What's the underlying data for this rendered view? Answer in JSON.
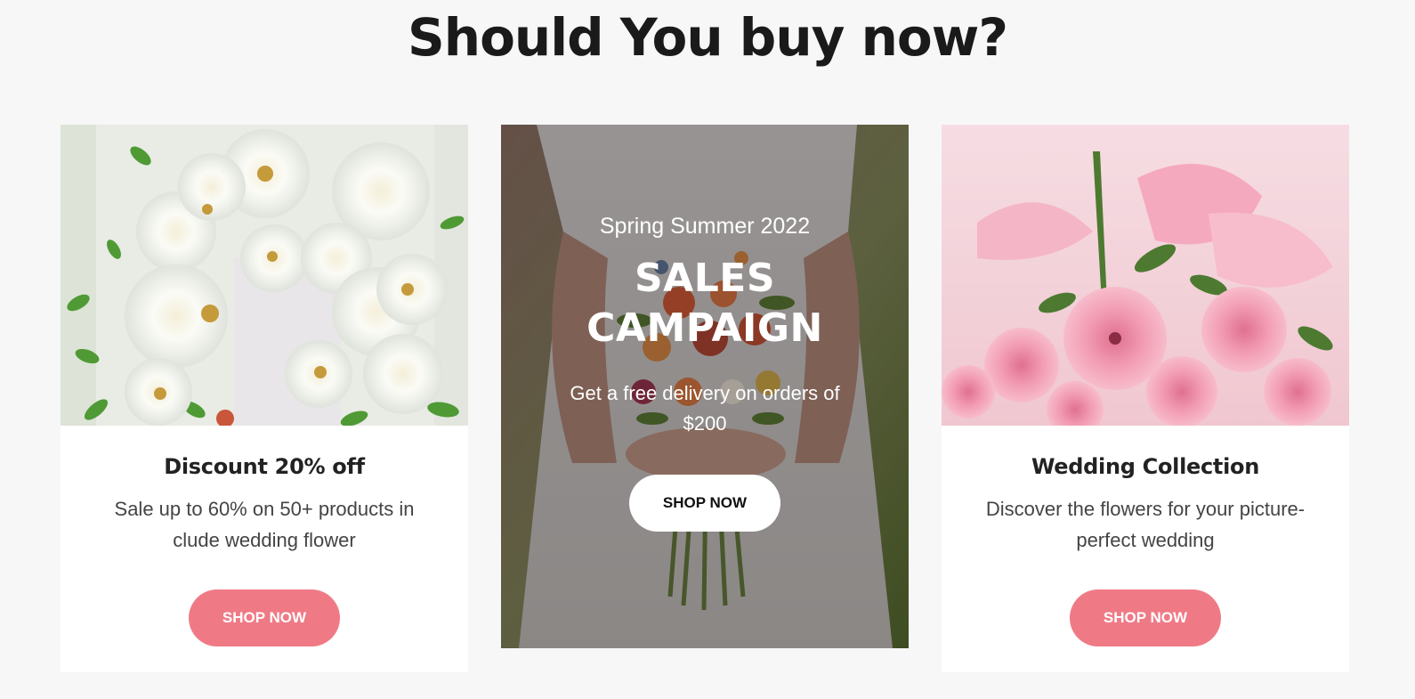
{
  "page": {
    "title": "Should You buy now?"
  },
  "cards": [
    {
      "heading": "Discount 20% off",
      "description": "Sale up to 60% on 50+ products in clude wedding flower",
      "button": "SHOP NOW",
      "image": "white-roses-bouquet"
    },
    {
      "kicker": "Spring Summer 2022",
      "headline_line1": "SALES",
      "headline_line2": "CAMPAIGN",
      "description": "Get a free delivery on orders of $200",
      "button": "SHOP NOW",
      "image": "bride-holding-bouquet"
    },
    {
      "heading": "Wedding Collection",
      "description": "Discover the flowers for your picture-perfect wedding",
      "button": "SHOP NOW",
      "image": "pink-roses-bouquet"
    }
  ],
  "colors": {
    "accent": "#ef7a86",
    "background": "#f7f7f7",
    "heading": "#1a1a1a"
  }
}
